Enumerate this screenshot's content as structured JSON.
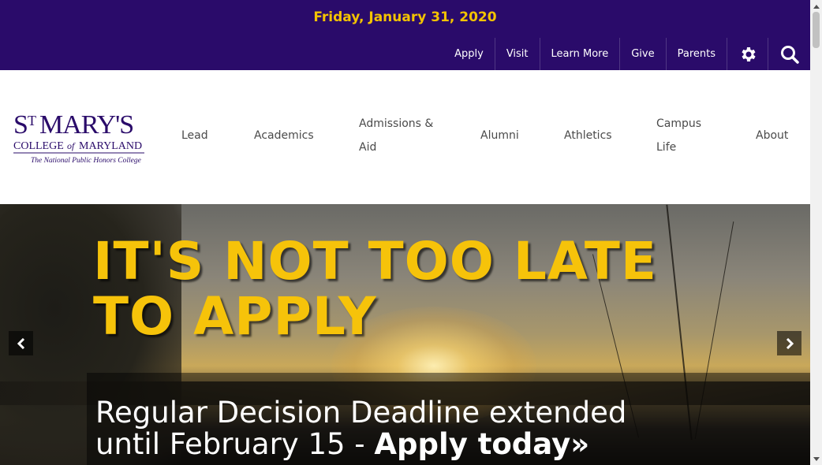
{
  "topbar": {
    "date": "Friday, January 31, 2020",
    "links": [
      "Apply",
      "Visit",
      "Learn More",
      "Give",
      "Parents"
    ],
    "settings_icon": "gear-icon",
    "search_icon": "search-icon"
  },
  "logo": {
    "line1": "ST MARY'S",
    "line2": "COLLEGE of MARYLAND",
    "tagline": "The National Public Honors College"
  },
  "nav": {
    "items": [
      {
        "label": "Lead"
      },
      {
        "label": "Academics"
      },
      {
        "label_line1": "Admissions &",
        "label_line2": "Aid"
      },
      {
        "label": "Alumni"
      },
      {
        "label": "Athletics"
      },
      {
        "label_line1": "Campus",
        "label_line2": "Life"
      },
      {
        "label": "About"
      }
    ]
  },
  "hero": {
    "headline_line1": "IT'S NOT TOO LATE",
    "headline_line2": "TO APPLY",
    "caption_line1": "Regular Decision Deadline extended",
    "caption_line2_prefix": "until February 15 - ",
    "caption_cta": "Apply today»",
    "prev_icon": "chevron-left-icon",
    "next_icon": "chevron-right-icon"
  },
  "colors": {
    "brand_purple": "#2a0b6a",
    "accent_gold": "#f3c300",
    "headline_gold": "#f6c30a"
  }
}
